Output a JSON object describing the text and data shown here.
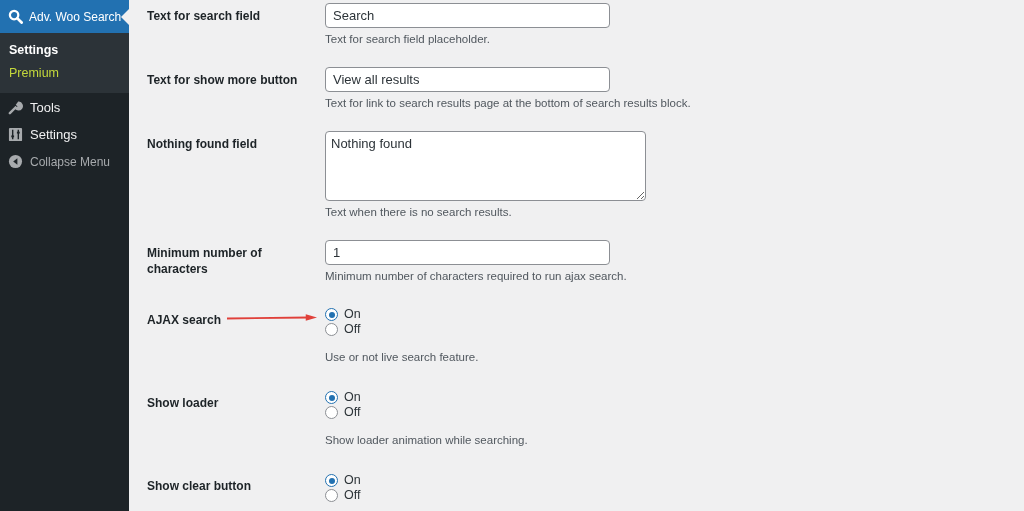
{
  "sidebar": {
    "menu_item": {
      "label": "Adv. Woo Search",
      "selected": true
    },
    "submenu": [
      {
        "label": "Settings",
        "selected": true
      },
      {
        "label": "Premium",
        "selected": false
      }
    ],
    "items": [
      {
        "label": "Tools"
      },
      {
        "label": "Settings"
      },
      {
        "label": "Collapse Menu"
      }
    ]
  },
  "settings": [
    {
      "kind": "text",
      "label": "Text for search field",
      "value": "Search",
      "description": "Text for search field placeholder."
    },
    {
      "kind": "text",
      "label": "Text for show more button",
      "value": "View all results",
      "description": "Text for link to search results page at the bottom of search results block."
    },
    {
      "kind": "textarea",
      "label": "Nothing found field",
      "value": "Nothing found",
      "description": "Text when there is no search results."
    },
    {
      "kind": "text",
      "label": "Minimum number of characters",
      "value": "1",
      "description": "Minimum number of characters required to run ajax search."
    },
    {
      "kind": "radio",
      "label": "AJAX search",
      "arrow": true,
      "options": [
        {
          "label": "On",
          "selected": true
        },
        {
          "label": "Off",
          "selected": false
        }
      ],
      "description": "Use or not live search feature."
    },
    {
      "kind": "radio",
      "label": "Show loader",
      "arrow": false,
      "options": [
        {
          "label": "On",
          "selected": true
        },
        {
          "label": "Off",
          "selected": false
        }
      ],
      "description": "Show loader animation while searching."
    },
    {
      "kind": "radio",
      "label": "Show clear button",
      "arrow": false,
      "options": [
        {
          "label": "On",
          "selected": true
        },
        {
          "label": "Off",
          "selected": false
        }
      ]
    }
  ]
}
